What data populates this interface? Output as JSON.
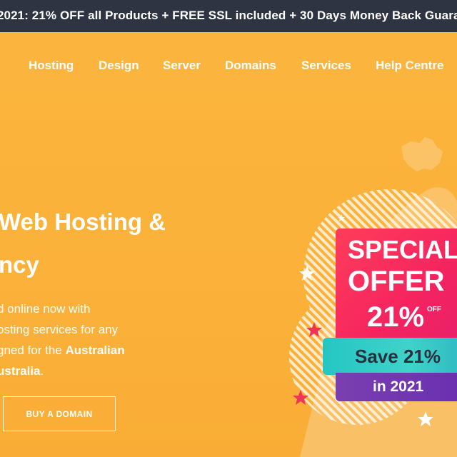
{
  "promo": {
    "text": "2021:  21% OFF all Products + FREE SSL included + 30 Days Money Back Guara"
  },
  "nav": {
    "items": [
      "Hosting",
      "Design",
      "Server",
      "Domains",
      "Services",
      "Help Centre"
    ]
  },
  "hero": {
    "line1": "Web Hosting &",
    "line2": "ncy",
    "desc": {
      "line1": "d online now with",
      "line2": "osting services for any",
      "line3_prefix": "gned for the ",
      "line3_bold": "Australian",
      "line4_bold": "ustralia",
      "line4_suffix": "."
    },
    "button_label": "BUY A DOMAIN"
  },
  "offer": {
    "title1": "SPECIAL",
    "title2": "OFFER",
    "percent": "21%",
    "off": "OFF",
    "save": "Save 21%",
    "year": "in 2021"
  },
  "colors": {
    "background": "#fbb13a",
    "promo_bar": "#2f3443",
    "badge_red": "#f5245f",
    "ribbon_teal": "#3fd3c9",
    "purple": "#6a2fb0"
  }
}
